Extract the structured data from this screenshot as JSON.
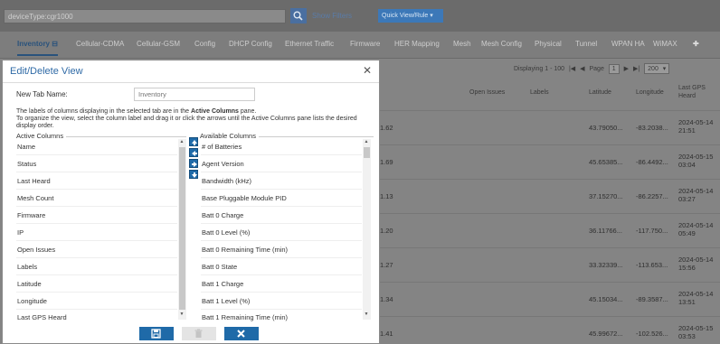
{
  "search": {
    "value": "deviceType:cgr1000"
  },
  "topbar": {
    "show_filters": "Show Filters",
    "quick_view": "Quick View/Rule"
  },
  "tabs": [
    {
      "label": "Inventory"
    },
    {
      "label": "Cellular-CDMA"
    },
    {
      "label": "Cellular-GSM"
    },
    {
      "label": "Config"
    },
    {
      "label": "DHCP Config"
    },
    {
      "label": "Ethernet Traffic"
    },
    {
      "label": "Firmware"
    },
    {
      "label": "HER Mapping"
    },
    {
      "label": "Mesh"
    },
    {
      "label": "Mesh Config"
    },
    {
      "label": "Physical"
    },
    {
      "label": "Tunnel"
    },
    {
      "label": "WPAN HA"
    },
    {
      "label": "WiMAX"
    }
  ],
  "grid": {
    "displaying": "Displaying 1 - 100",
    "page_label": "Page",
    "page_value": "1",
    "page_size": "200",
    "columns": [
      "Open Issues",
      "Labels",
      "Latitude",
      "Longitude",
      "Last GPS Heard"
    ],
    "rows": [
      {
        "partial": "1.62",
        "latitude": "43.79050...",
        "longitude": "-83.2038...",
        "heard": "2024-05-14 21:51"
      },
      {
        "partial": "1.69",
        "latitude": "45.65385...",
        "longitude": "-86.4492...",
        "heard": "2024-05-15 03:04"
      },
      {
        "partial": "1.13",
        "latitude": "37.15270...",
        "longitude": "-86.2257...",
        "heard": "2024-05-14 03:27"
      },
      {
        "partial": "1.20",
        "latitude": "36.11766...",
        "longitude": "-117.750...",
        "heard": "2024-05-14 05:49"
      },
      {
        "partial": "1.27",
        "latitude": "33.32339...",
        "longitude": "-113.653...",
        "heard": "2024-05-14 15:56"
      },
      {
        "partial": "1.34",
        "latitude": "45.15034...",
        "longitude": "-89.3587...",
        "heard": "2024-05-14 13:51"
      },
      {
        "partial": "1.41",
        "latitude": "45.99672...",
        "longitude": "-102.526...",
        "heard": "2024-05-15 03:53"
      }
    ]
  },
  "modal": {
    "title": "Edit/Delete View",
    "new_tab_label": "New Tab Name:",
    "new_tab_value": "Inventory",
    "instr_1": "The labels of columns displaying in the selected tab are in the",
    "instr_bold": "Active Columns",
    "instr_2": "pane.",
    "instr_3": "To organize the view, select the column label and drag it or click the arrows until the Active Columns pane lists the desired display order.",
    "active_legend": "Active Columns",
    "available_legend": "Available Columns",
    "active_columns": [
      "Name",
      "Status",
      "Last Heard",
      "Mesh Count",
      "Firmware",
      "IP",
      "Open Issues",
      "Labels",
      "Latitude",
      "Longitude",
      "Last GPS Heard"
    ],
    "available_columns": [
      "# of Batteries",
      "Agent Version",
      "Bandwidth (kHz)",
      "Base Pluggable Module PID",
      "Batt 0 Charge",
      "Batt 0 Level (%)",
      "Batt 0 Remaining Time (min)",
      "Batt 0 State",
      "Batt 1 Charge",
      "Batt 1 Level (%)",
      "Batt 1 Remaining Time (min)"
    ]
  }
}
